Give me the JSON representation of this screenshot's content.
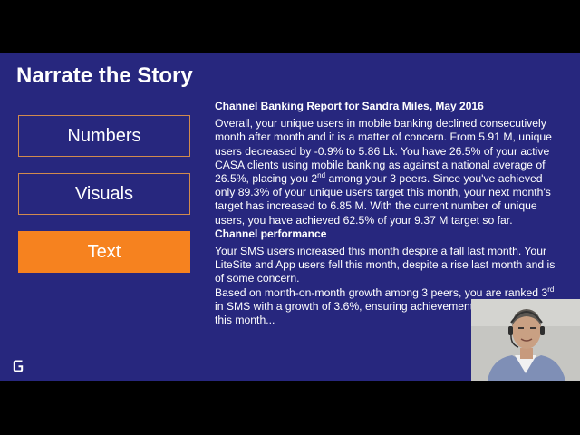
{
  "slide": {
    "title": "Narrate the Story",
    "nav": {
      "numbers": "Numbers",
      "visuals": "Visuals",
      "text": "Text"
    },
    "report": {
      "heading": "Channel Banking Report for Sandra Miles, May 2016",
      "para_a": "Overall, your unique users in mobile banking declined consecutively month after month and it is a matter of concern. From 5.91 M, unique users decreased by -0.9% to 5.86 Lk. You have 26.5% of your active CASA clients using mobile banking as against a national average of 26.5%, placing you 2",
      "sup": "nd",
      "para_b": " among your 3 peers. Since you've achieved only 89.3% of your unique users target this month, your next month's target has increased to 6.85 M. With the current number of unique users, you have achieved 62.5% of your 9.37 M target so far."
    },
    "performance": {
      "heading": "Channel performance",
      "para1": "Your SMS users increased this month despite a fall last month. Your LiteSite and App users fell this month, despite a rise last month and is of some concern.",
      "para2_a": "Based on month-on-month growth among 3 peers, you are ranked 3",
      "para2_sup": "rd",
      "para2_b": " in SMS with a growth of 3.6%, ensuring achievement of your targets this month..."
    }
  },
  "colors": {
    "slide_bg": "#27277e",
    "accent": "#f6821f",
    "frame": "#000000"
  },
  "icons": {
    "logo": "g-logo-icon",
    "webcam": "webcam-presenter"
  }
}
